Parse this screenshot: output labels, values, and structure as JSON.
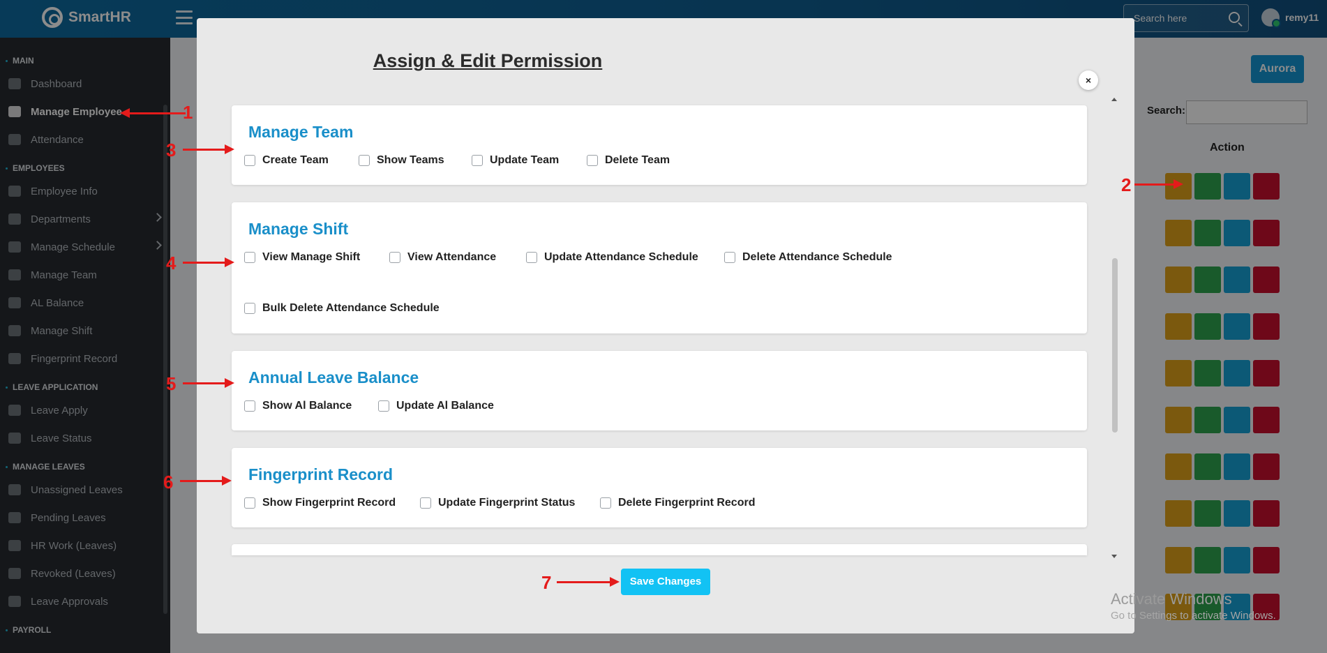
{
  "topbar": {
    "brand": "SmartHR",
    "search_placeholder": "Search here",
    "username": "remy11"
  },
  "sidebar": {
    "sections": [
      {
        "title": "MAIN",
        "items": [
          "Dashboard",
          "Manage Employee",
          "Attendance"
        ]
      },
      {
        "title": "EMPLOYEES",
        "items": [
          "Employee Info",
          "Departments",
          "Manage Schedule",
          "Manage Team",
          "AL Balance",
          "Manage Shift",
          "Fingerprint Record"
        ]
      },
      {
        "title": "LEAVE APPLICATION",
        "items": [
          "Leave Apply",
          "Leave Status"
        ]
      },
      {
        "title": "MANAGE LEAVES",
        "items": [
          "Unassigned Leaves",
          "Pending Leaves",
          "HR Work (Leaves)",
          "Revoked (Leaves)",
          "Leave Approvals"
        ]
      },
      {
        "title": "PAYROLL",
        "items": []
      }
    ],
    "active": "Manage Employee"
  },
  "page": {
    "aurora_button": "Aurora",
    "search_label": "Search:",
    "action_header": "Action"
  },
  "modal": {
    "title": "Assign & Edit Permission",
    "close_label": "×",
    "save_label": "Save Changes",
    "sections": [
      {
        "title": "Manage Team",
        "perms": [
          "Create Team",
          "Show Teams",
          "Update Team",
          "Delete Team"
        ]
      },
      {
        "title": "Manage Shift",
        "perms": [
          "View Manage Shift",
          "View Attendance",
          "Update Attendance Schedule",
          "Delete Attendance Schedule",
          "Bulk Delete Attendance Schedule"
        ]
      },
      {
        "title": "Annual Leave Balance",
        "perms": [
          "Show Al Balance",
          "Update Al Balance"
        ]
      },
      {
        "title": "Fingerprint Record",
        "perms": [
          "Show Fingerprint Record",
          "Update Fingerprint Status",
          "Delete Fingerprint Record"
        ]
      }
    ]
  },
  "annotations": [
    "1",
    "2",
    "3",
    "4",
    "5",
    "6",
    "7"
  ],
  "watermark": {
    "line1": "Activate Windows",
    "line2": "Go to Settings to activate Windows."
  },
  "colors": {
    "accent": "#1a8fc9",
    "save": "#12c2f4",
    "arrow": "#e41b1b",
    "btn_lock": "#e0a31a",
    "btn_key": "#2ea44f",
    "btn_edit": "#17a2d8",
    "btn_delete": "#c8102e"
  }
}
